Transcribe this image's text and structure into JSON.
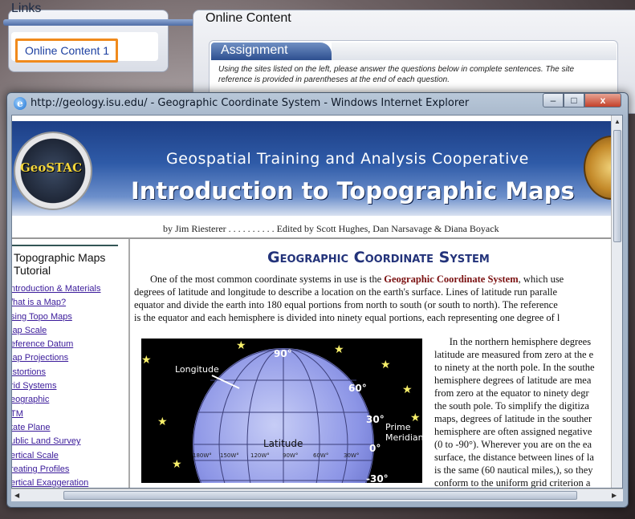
{
  "links": {
    "title": "Links",
    "item": "Online Content 1"
  },
  "content": {
    "title": "Online Content",
    "assignment_tab": "Assignment",
    "assignment_text": "Using the sites listed on the left, please answer the questions below in complete sentences. The site reference is provided in parentheses at the end of each question."
  },
  "browser": {
    "title": "http://geology.isu.edu/ - Geographic Coordinate System - Windows Internet Explorer",
    "icon": "ie-e-icon",
    "minimize": "–",
    "maximize": "□",
    "close": "x"
  },
  "page": {
    "banner_line1": "Geospatial Training and Analysis  Cooperative",
    "banner_line2": "Introduction to Topographic Maps",
    "logo_text": "GeoSTAC",
    "byline": "by Jim Riesterer . . . . . . . . . . Edited by Scott Hughes, Dan Narsavage & Diana Boyack",
    "sidebar_title_1": "Topographic Maps",
    "sidebar_title_2": "Tutorial",
    "sidebar_links": [
      "ntroduction & Materials",
      "/hat is a Map?",
      "sing Topo Maps",
      "lap Scale",
      "eference Datum",
      "lap Projections",
      "istortions",
      "rid Systems",
      "eographic",
      "TM",
      "tate Plane",
      "ublic Land Survey",
      "ertical Scale",
      "reating Profiles",
      "ertical Exaggeration"
    ],
    "heading": "Geographic Coordinate System",
    "para1_lines": [
      "One of the most common coordinate systems in use is the ",
      "degrees of latitude and longitude to describe a location on the earth's surface. Lines of latitude run paralle",
      "equator and divide the earth into 180 equal portions from north to south (or south to north). The reference",
      "is the equator and each hemisphere is divided into ninety equal portions, each representing one degree of l"
    ],
    "para1_bold": "Geographic Coordinate System",
    "para1_tail": ", which use",
    "para2_lines": [
      "      In the northern hemisphere degrees",
      "latitude are measured from zero at the e",
      "to ninety at the north pole. In the southe",
      "hemisphere degrees of latitude are mea",
      "from zero at the equator to ninety degr",
      "the south pole. To simplify the digitiza",
      "maps, degrees of latitude in the souther",
      "hemisphere are often assigned negative",
      "(0 to -90°). Wherever you are on the ea",
      "surface, the distance between lines of la",
      "is the same (60 nautical miles,), so they",
      "conform to the uniform grid criterion a"
    ],
    "globe": {
      "longitude_label": "Longitude",
      "latitude_label": "Latitude",
      "prime_meridian_1": "Prime",
      "prime_meridian_2": "Meridian",
      "deg_90": "90°",
      "deg_60": "60°",
      "deg_30": "30°",
      "deg_0": "0°",
      "deg_m30": "-30°",
      "lon_labels": [
        "180W°",
        "150W°",
        "120W°",
        "90W°",
        "60W°",
        "30W°"
      ]
    }
  },
  "colors": {
    "accent_orange": "#f08a1c",
    "link_blue": "#1b3fa0",
    "heading_navy": "#23337a"
  }
}
